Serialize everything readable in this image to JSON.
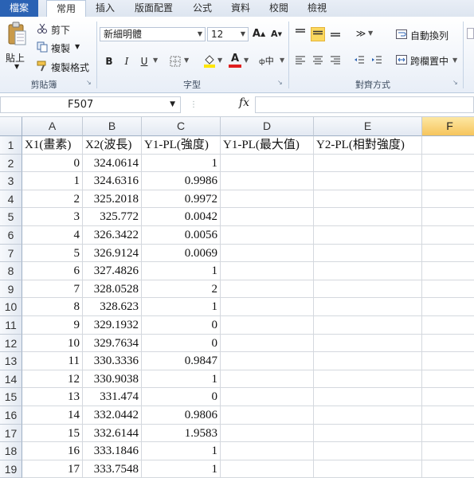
{
  "ribbon_tabs": [
    "檔案",
    "常用",
    "插入",
    "版面配置",
    "公式",
    "資料",
    "校閱",
    "檢視"
  ],
  "clipboard": {
    "paste": "貼上",
    "cut": "剪下",
    "copy": "複製",
    "format_painter": "複製格式",
    "group_label": "剪貼簿"
  },
  "font": {
    "name": "新細明體",
    "size": "12",
    "grow": "A",
    "shrink": "A",
    "bold": "B",
    "italic": "I",
    "underline": "U",
    "font_color_label": "A",
    "phonetic": "中",
    "group_label": "字型"
  },
  "alignment": {
    "wrap_text": "自動換列",
    "merge_center": "跨欄置中",
    "group_label": "對齊方式"
  },
  "formula_bar": {
    "name_box": "F507",
    "fx": "fx",
    "value": ""
  },
  "columns": [
    "A",
    "B",
    "C",
    "D",
    "E",
    "F"
  ],
  "selected_column": "F",
  "rows": [
    {
      "n": "1",
      "cells": [
        "X1(畫素)",
        "X2(波長)",
        "Y1-PL(強度)",
        "Y1-PL(最大值)",
        "Y2-PL(相對強度)",
        ""
      ]
    },
    {
      "n": "2",
      "cells": [
        "0",
        "324.0614",
        "1",
        "",
        "",
        ""
      ]
    },
    {
      "n": "3",
      "cells": [
        "1",
        "324.6316",
        "0.9986",
        "",
        "",
        ""
      ]
    },
    {
      "n": "4",
      "cells": [
        "2",
        "325.2018",
        "0.9972",
        "",
        "",
        ""
      ]
    },
    {
      "n": "5",
      "cells": [
        "3",
        "325.772",
        "0.0042",
        "",
        "",
        ""
      ]
    },
    {
      "n": "6",
      "cells": [
        "4",
        "326.3422",
        "0.0056",
        "",
        "",
        ""
      ]
    },
    {
      "n": "7",
      "cells": [
        "5",
        "326.9124",
        "0.0069",
        "",
        "",
        ""
      ]
    },
    {
      "n": "8",
      "cells": [
        "6",
        "327.4826",
        "1",
        "",
        "",
        ""
      ]
    },
    {
      "n": "9",
      "cells": [
        "7",
        "328.0528",
        "2",
        "",
        "",
        ""
      ]
    },
    {
      "n": "10",
      "cells": [
        "8",
        "328.623",
        "1",
        "",
        "",
        ""
      ]
    },
    {
      "n": "11",
      "cells": [
        "9",
        "329.1932",
        "0",
        "",
        "",
        ""
      ]
    },
    {
      "n": "12",
      "cells": [
        "10",
        "329.7634",
        "0",
        "",
        "",
        ""
      ]
    },
    {
      "n": "13",
      "cells": [
        "11",
        "330.3336",
        "0.9847",
        "",
        "",
        ""
      ]
    },
    {
      "n": "14",
      "cells": [
        "12",
        "330.9038",
        "1",
        "",
        "",
        ""
      ]
    },
    {
      "n": "15",
      "cells": [
        "13",
        "331.474",
        "0",
        "",
        "",
        ""
      ]
    },
    {
      "n": "16",
      "cells": [
        "14",
        "332.0442",
        "0.9806",
        "",
        "",
        ""
      ]
    },
    {
      "n": "17",
      "cells": [
        "15",
        "332.6144",
        "1.9583",
        "",
        "",
        ""
      ]
    },
    {
      "n": "18",
      "cells": [
        "16",
        "333.1846",
        "1",
        "",
        "",
        ""
      ]
    },
    {
      "n": "19",
      "cells": [
        "17",
        "333.7548",
        "1",
        "",
        "",
        ""
      ]
    }
  ],
  "colors": {
    "file_tab": "#2a62b4",
    "selected_header": "#f6c55c",
    "highlight_yellow": "#ffe600",
    "font_red": "#e02020"
  }
}
